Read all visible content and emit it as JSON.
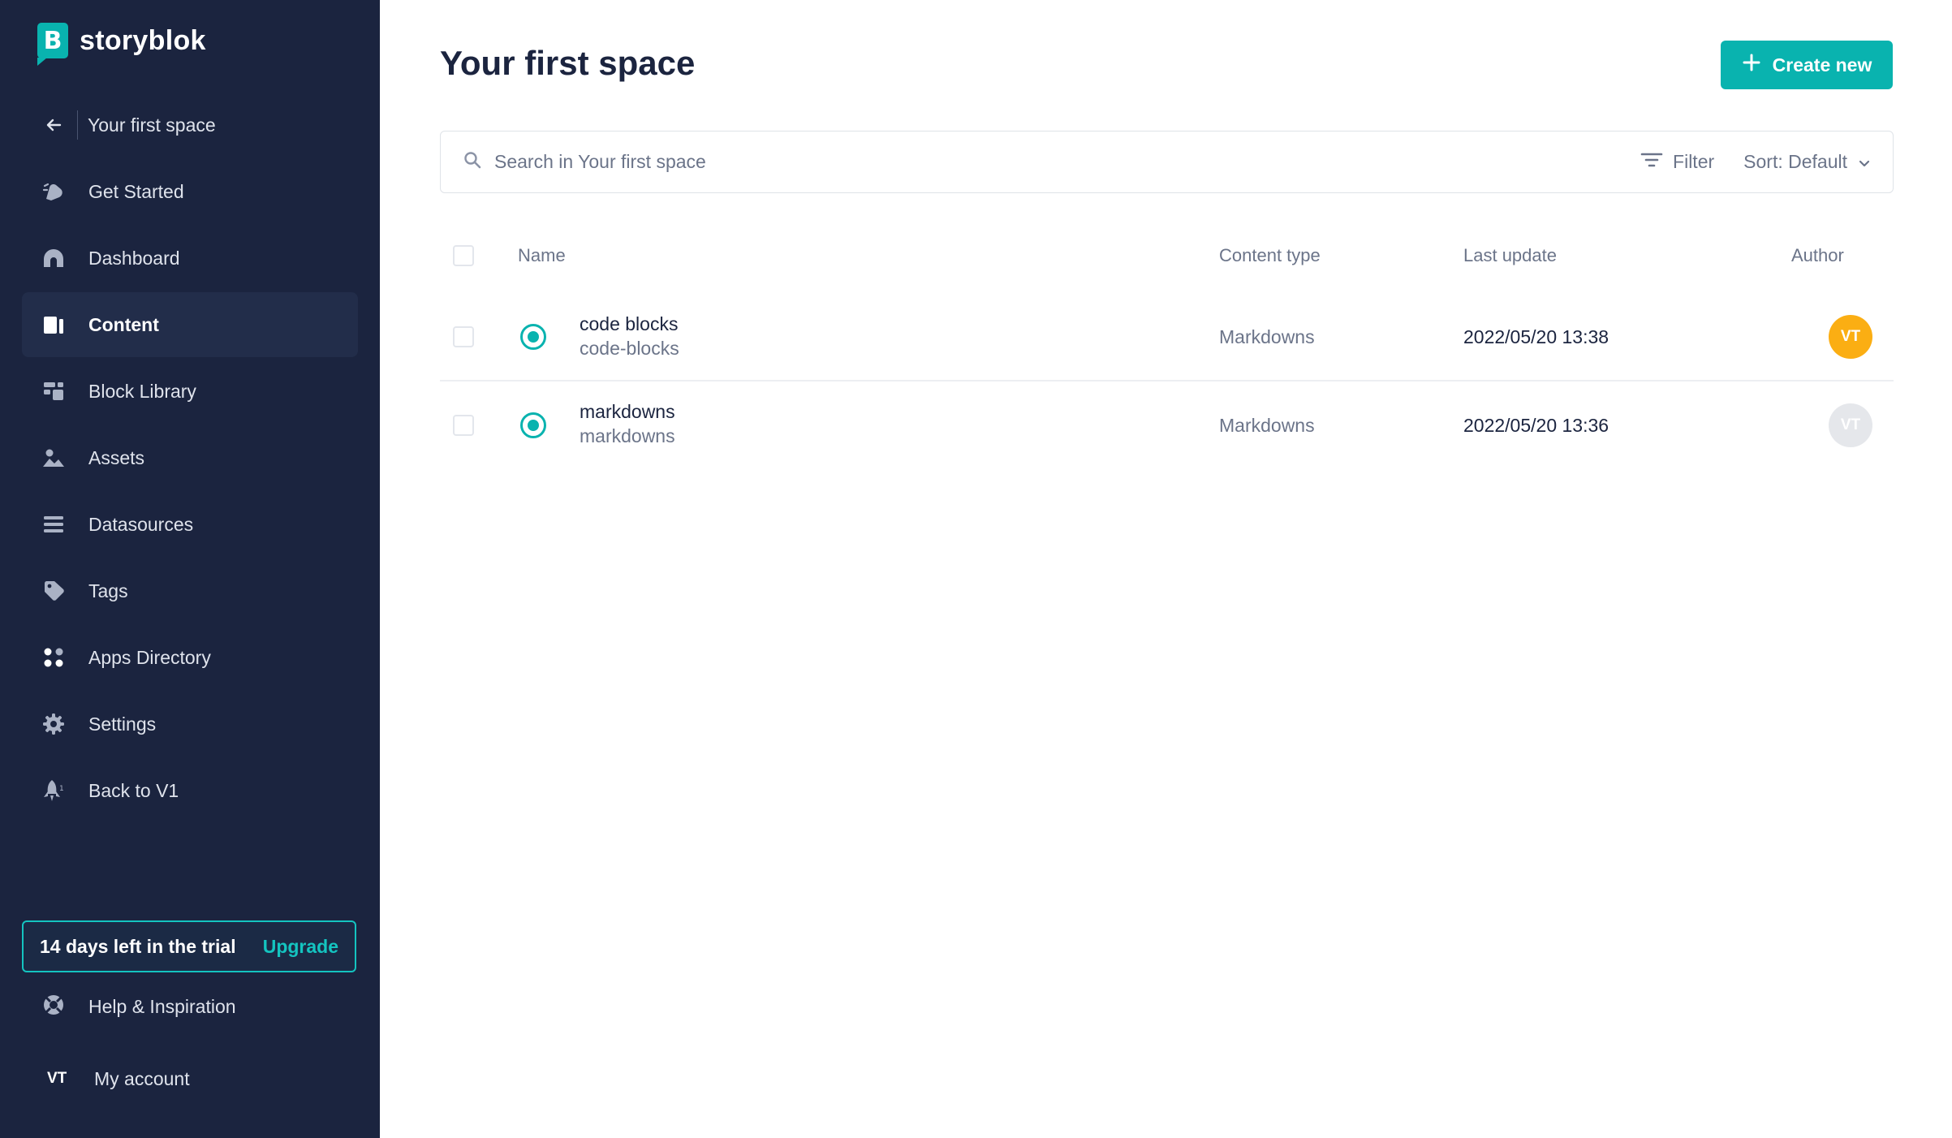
{
  "app": {
    "logo_text": "storyblok",
    "logo_letter": "B",
    "accent_color": "#09b3af"
  },
  "sidebar": {
    "back_item": {
      "label": "Your first space",
      "icon": "arrow-left-icon"
    },
    "items": [
      {
        "label": "Get Started",
        "icon": "rocket-hand-icon"
      },
      {
        "label": "Dashboard",
        "icon": "dashboard-icon"
      },
      {
        "label": "Content",
        "icon": "content-icon",
        "active": true
      },
      {
        "label": "Block Library",
        "icon": "blocks-icon"
      },
      {
        "label": "Assets",
        "icon": "assets-icon"
      },
      {
        "label": "Datasources",
        "icon": "datasources-icon"
      },
      {
        "label": "Tags",
        "icon": "tag-icon"
      },
      {
        "label": "Apps Directory",
        "icon": "apps-icon"
      },
      {
        "label": "Settings",
        "icon": "gear-icon"
      },
      {
        "label": "Back to V1",
        "icon": "rocket-icon"
      }
    ],
    "trial": {
      "text": "14 days left in the trial",
      "upgrade_label": "Upgrade"
    },
    "help": {
      "label": "Help & Inspiration",
      "icon": "lifebuoy-icon"
    },
    "account": {
      "initials": "VT",
      "label": "My account"
    }
  },
  "main": {
    "title": "Your first space",
    "create_button": {
      "label": "Create new",
      "icon": "plus-icon"
    },
    "search": {
      "placeholder": "Search in Your first space",
      "value": ""
    },
    "filter_label": "Filter",
    "sort_label": "Sort: Default",
    "table": {
      "headers": {
        "name": "Name",
        "content_type": "Content type",
        "last_update": "Last update",
        "author": "Author"
      },
      "rows": [
        {
          "title": "code blocks",
          "slug": "code-blocks",
          "content_type": "Markdowns",
          "last_update": "2022/05/20 13:38",
          "author_initials": "VT",
          "author_color": "#fbae13"
        },
        {
          "title": "markdowns",
          "slug": "markdowns",
          "content_type": "Markdowns",
          "last_update": "2022/05/20 13:36",
          "author_initials": "VT",
          "author_color": "#e5e7eb"
        }
      ]
    }
  }
}
